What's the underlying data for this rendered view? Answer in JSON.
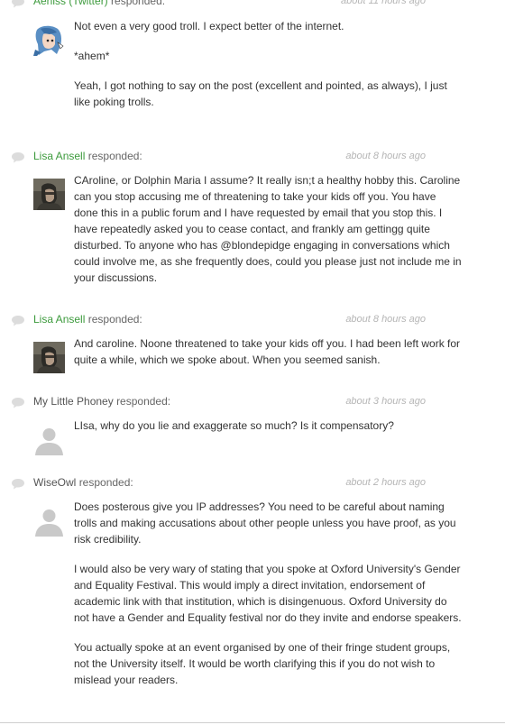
{
  "responded_label": "responded:",
  "colors": {
    "author_link": "#3c9a3c",
    "timestamp": "#b5b5b5",
    "text": "#333333"
  },
  "comments": [
    {
      "author": "Aeniss (Twitter)",
      "author_is_link": true,
      "time": "about 11 hours ago",
      "avatar": "anime-avatar",
      "paragraphs": [
        "Not even a very good troll. I expect better of the internet.",
        "*ahem*",
        "Yeah, I got nothing to say on the post (excellent and pointed, as always), I just like poking trolls."
      ]
    },
    {
      "author": "Lisa Ansell",
      "author_is_link": true,
      "time": "about 8 hours ago",
      "avatar": "photo-avatar",
      "paragraphs": [
        "CAroline, or Dolphin Maria I assume? It really isn;t a healthy hobby this. Caroline can you stop accusing me of threatening to take your kids off you. You have done this in a public forum and I have requested by email that you stop this. I have repeatedly asked you to cease contact, and frankly am gettingg quite disturbed. To anyone who has @blondepidge engaging in conversations which could involve me, as she frequently does, could you please just not include me in your discussions."
      ]
    },
    {
      "author": "Lisa Ansell",
      "author_is_link": true,
      "time": "about 8 hours ago",
      "avatar": "photo-avatar",
      "paragraphs": [
        "And caroline. Noone threatened to take your kids off you. I had been left work for quite a while, which we spoke about. When you seemed sanish."
      ]
    },
    {
      "author": "My Little Phoney",
      "author_is_link": false,
      "time": "about 3 hours ago",
      "avatar": "default-avatar",
      "paragraphs": [
        "LIsa, why do you lie and exaggerate so much? Is it compensatory?"
      ]
    },
    {
      "author": "WiseOwl",
      "author_is_link": false,
      "time": "about 2 hours ago",
      "avatar": "default-avatar",
      "paragraphs": [
        "Does posterous give you IP addresses? You need to be careful about naming trolls and making accusations about other people unless you have proof, as you risk credibility.",
        "I would also be very wary of stating that you spoke at Oxford University's Gender and Equality Festival. This would imply a direct invitation, endorsement of academic link with that institution, which is disingenuous. Oxford University do not have a Gender and Equality festival nor do they invite and endorse speakers.",
        "You actually spoke at an event organised by one of their fringe student groups, not the University itself. It would be worth clarifying this if you do not wish to mislead your readers."
      ]
    }
  ]
}
